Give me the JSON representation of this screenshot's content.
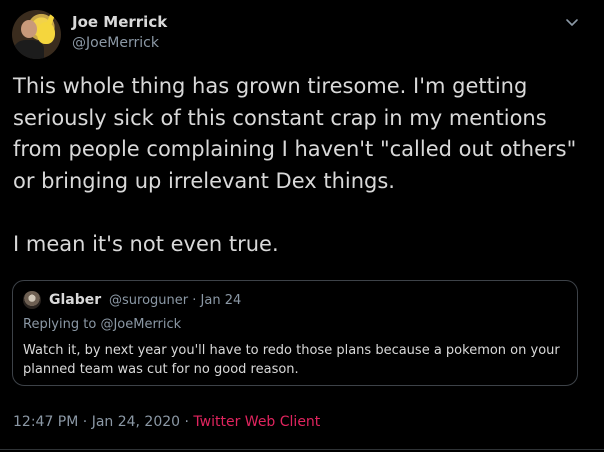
{
  "tweet": {
    "author_name": "Joe Merrick",
    "author_handle": "@JoeMerrick",
    "text": "This whole thing has grown tiresome. I'm getting seriously sick of this constant crap in my mentions from people complaining I haven't \"called out others\" or bringing up irrelevant Dex things.\n\nI mean it's not even true.",
    "quoted": {
      "author_name": "Glaber",
      "author_handle": "@suroguner",
      "separator": "·",
      "date": "Jan 24",
      "replying_label": "Replying to",
      "replying_handle": "@JoeMerrick",
      "text": "Watch it, by next year you'll have to redo those plans because a pokemon on your planned team was cut for no good reason."
    },
    "time": "12:47 PM",
    "separator": "·",
    "date": "Jan 24, 2020",
    "client": "Twitter Web Client"
  },
  "colors": {
    "background": "#000000",
    "text": "#d9d9d9",
    "muted": "#8b98a5",
    "client_link": "#e0245e",
    "border": "#3d4248"
  },
  "icons": {
    "avatar": "profile-photo",
    "caret": "chevron-down-icon"
  }
}
